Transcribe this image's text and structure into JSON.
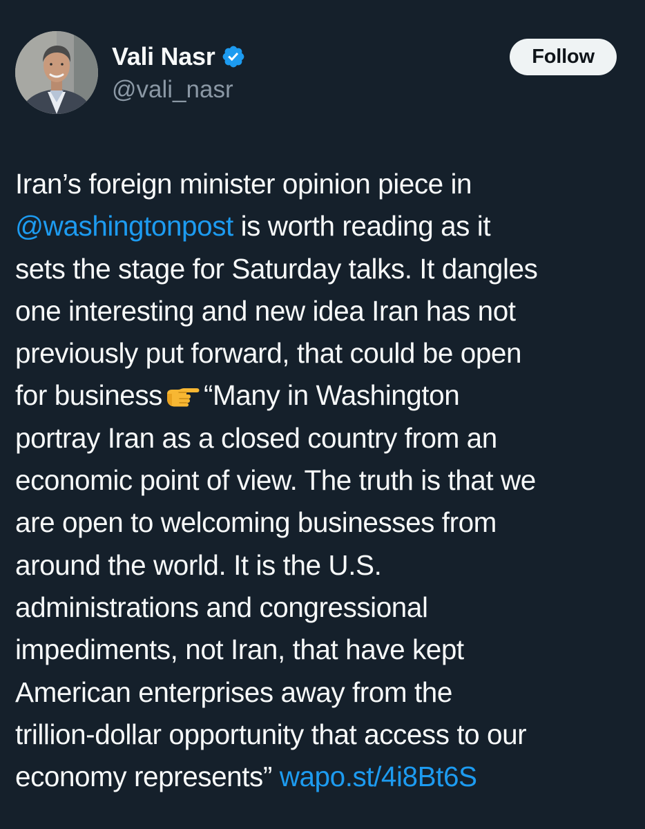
{
  "author": {
    "display_name": "Vali Nasr",
    "handle": "@vali_nasr",
    "verified_icon": "verified-badge-icon",
    "avatar": "profile-photo"
  },
  "actions": {
    "follow_label": "Follow"
  },
  "tweet": {
    "lines": [
      {
        "text": "Iran’s foreign minister opinion piece in"
      },
      {
        "mention": "@washingtonpost",
        "text": " is worth reading as it"
      },
      {
        "text": "sets the stage for Saturday talks. It dangles"
      },
      {
        "text": "one interesting and new idea Iran has not"
      },
      {
        "text": "previously put forward, that could be open"
      },
      {
        "text_before": "for business",
        "icon": "pointing-right-hand-emoji",
        "text_after": "“Many in Washington"
      },
      {
        "text": "portray Iran as a closed country from an"
      },
      {
        "text": "economic point of view. The truth is that we"
      },
      {
        "text": "are open to welcoming businesses from"
      },
      {
        "text": "around the world. It is the U.S."
      },
      {
        "text": "administrations and congressional"
      },
      {
        "text": "impediments, not Iran, that have kept"
      },
      {
        "text": "American enterprises away from the"
      },
      {
        "text": "trillion-dollar opportunity that access to our"
      },
      {
        "text": "economy represents”",
        "link": "wapo.st/4i8Bt6S"
      }
    ]
  },
  "colors": {
    "background": "#15202b",
    "text": "#f7f9f9",
    "secondary_text": "#8b98a5",
    "link": "#1d9bf0",
    "follow_button_bg": "#eff3f4"
  }
}
